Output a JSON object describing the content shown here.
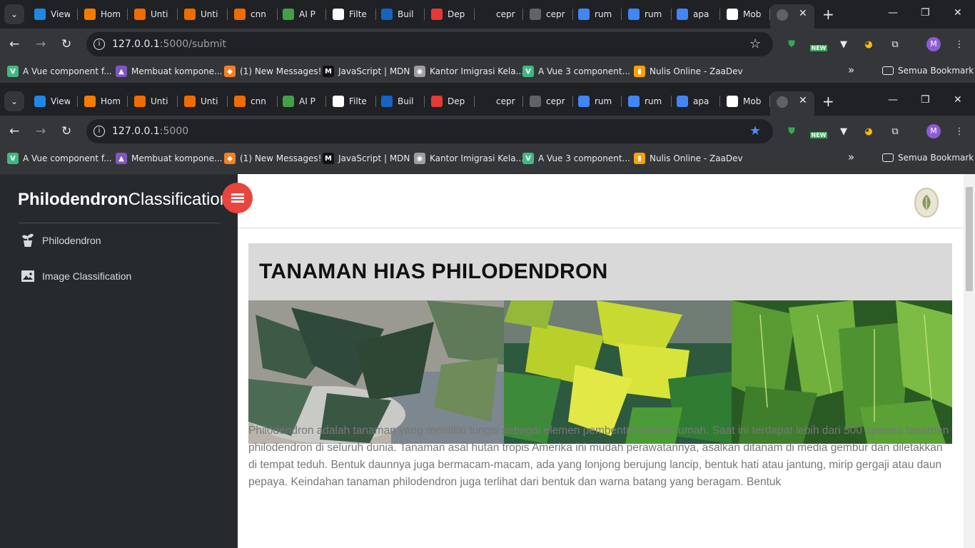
{
  "tabs": [
    {
      "label": "View",
      "color": "#1e88e5"
    },
    {
      "label": "Hom",
      "color": "#f57c00"
    },
    {
      "label": "Unti",
      "color": "#ef6c00"
    },
    {
      "label": "Unti",
      "color": "#ef6c00"
    },
    {
      "label": "cnn",
      "color": "#ef6c00"
    },
    {
      "label": "AI P",
      "color": "#43a047"
    },
    {
      "label": "Filte",
      "color": "#ffffff"
    },
    {
      "label": "Buil",
      "color": "#1565c0"
    },
    {
      "label": "Dep",
      "color": "#e53935"
    },
    {
      "label": "cepr",
      "color": "#202124"
    },
    {
      "label": "cepr",
      "color": "#5f6368"
    },
    {
      "label": "rum",
      "color": "#4285f4"
    },
    {
      "label": "rum",
      "color": "#4285f4"
    },
    {
      "label": "apa",
      "color": "#4285f4"
    },
    {
      "label": "Mob",
      "color": "#ffffff"
    }
  ],
  "window1": {
    "url_host": "127.0.0.1",
    "url_path": ":5000/submit"
  },
  "window2": {
    "url_host": "127.0.0.1",
    "url_path": ":5000"
  },
  "ext_new_badge": "NEW",
  "avatar_letter": "M",
  "bookmarks": [
    {
      "label": "A Vue component f...",
      "color": "#41b883",
      "glyph": "V"
    },
    {
      "label": "Membuat kompone...",
      "color": "#7e57c2",
      "glyph": "▲"
    },
    {
      "label": "(1) New Messages!",
      "color": "#f48024",
      "glyph": "◆"
    },
    {
      "label": "JavaScript | MDN",
      "color": "#111111",
      "glyph": "M"
    },
    {
      "label": "Kantor Imigrasi Kela...",
      "color": "#9e9e9e",
      "glyph": "◉"
    },
    {
      "label": "A Vue 3 component...",
      "color": "#41b883",
      "glyph": "V"
    },
    {
      "label": "Nulis Online - ZaaDev",
      "color": "#ffa000",
      "glyph": "▮"
    }
  ],
  "bookmarks_more": "»",
  "bookmarks_folder": "Semua Bookmark",
  "sidebar": {
    "brand_bold": "Philodendron",
    "brand_light": "Classification",
    "items": [
      {
        "label": "Philodendron",
        "icon": "plant-icon"
      },
      {
        "label": "Image Classification",
        "icon": "image-icon"
      }
    ]
  },
  "main": {
    "title": "TANAMAN HIAS PHILODENDRON",
    "images": [
      "philodendron-xanadu-photo",
      "philodendron-prince-of-orange-photo",
      "philodendron-leaves-photo"
    ],
    "description": "Philodendron adalah tanaman yang memiliki fungsi sebagai elemen pembentuk taman rumah. Saat ini terdapat lebih dari 500 spesies tanaman philodendron di seluruh dunia. Tanaman asal hutan tropis Amerika ini mudah perawatannya, asalkan ditanam di media gembur dan diletakkan di tempat teduh.  Bentuk daunnya juga bermacam-macam, ada yang lonjong berujung lancip, bentuk hati atau jantung, mirip gergaji atau daun pepaya.  Keindahan tanaman philodendron juga terlihat dari bentuk dan warna batang yang beragam. Bentuk"
  },
  "colors": {
    "accent_red": "#e8453c",
    "sidebar_bg": "#262a2f",
    "title_bg": "#d9d9d9"
  }
}
